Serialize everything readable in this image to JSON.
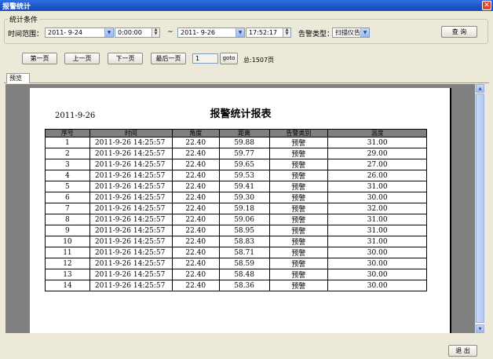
{
  "window": {
    "title": "报警统计",
    "close_glyph": "✕"
  },
  "conditions": {
    "group_title": "统计条件",
    "range_label": "时间范围：",
    "start_date": "2011- 9-24",
    "start_time": "0:00:00",
    "tilde": "~",
    "end_date": "2011- 9-26",
    "end_time": "17:52:17",
    "alarm_type_label": "告警类型：",
    "alarm_type_value": "扫描仪告",
    "query_label": "查 询"
  },
  "pager": {
    "first": "第一页",
    "prev": "上一页",
    "next": "下一页",
    "last": "最后一页",
    "page_value": "1",
    "goto": "goto",
    "total": "总:1507页"
  },
  "tabs": {
    "preview": "预览"
  },
  "report": {
    "date": "2011-9-26",
    "title": "报警统计报表",
    "columns": [
      "序号",
      "时间",
      "角度",
      "距离",
      "告警类别",
      "温度"
    ],
    "rows": [
      [
        "1",
        "2011-9-26  14:25:57",
        "22.40",
        "59.88",
        "预警",
        "31.00"
      ],
      [
        "2",
        "2011-9-26  14:25:57",
        "22.40",
        "59.77",
        "预警",
        "29.00"
      ],
      [
        "3",
        "2011-9-26  14:25:57",
        "22.40",
        "59.65",
        "预警",
        "27.00"
      ],
      [
        "4",
        "2011-9-26  14:25:57",
        "22.40",
        "59.53",
        "预警",
        "26.00"
      ],
      [
        "5",
        "2011-9-26  14:25:57",
        "22.40",
        "59.41",
        "预警",
        "31.00"
      ],
      [
        "6",
        "2011-9-26  14:25:57",
        "22.40",
        "59.30",
        "预警",
        "30.00"
      ],
      [
        "7",
        "2011-9-26  14:25:57",
        "22.40",
        "59.18",
        "预警",
        "32.00"
      ],
      [
        "8",
        "2011-9-26  14:25:57",
        "22.40",
        "59.06",
        "预警",
        "31.00"
      ],
      [
        "9",
        "2011-9-26  14:25:57",
        "22.40",
        "58.95",
        "预警",
        "31.00"
      ],
      [
        "10",
        "2011-9-26  14:25:57",
        "22.40",
        "58.83",
        "预警",
        "31.00"
      ],
      [
        "11",
        "2011-9-26  14:25:57",
        "22.40",
        "58.71",
        "预警",
        "30.00"
      ],
      [
        "12",
        "2011-9-26  14:25:57",
        "22.40",
        "58.59",
        "预警",
        "30.00"
      ],
      [
        "13",
        "2011-9-26  14:25:57",
        "22.40",
        "58.48",
        "预警",
        "30.00"
      ],
      [
        "14",
        "2011-9-26  14:25:57",
        "22.40",
        "58.36",
        "预警",
        "30.00"
      ]
    ]
  },
  "footer": {
    "exit": "退 出"
  },
  "colors": {
    "titlebar": "#1b55c8",
    "preview_bg": "#808080",
    "header_fill": "#808080"
  }
}
